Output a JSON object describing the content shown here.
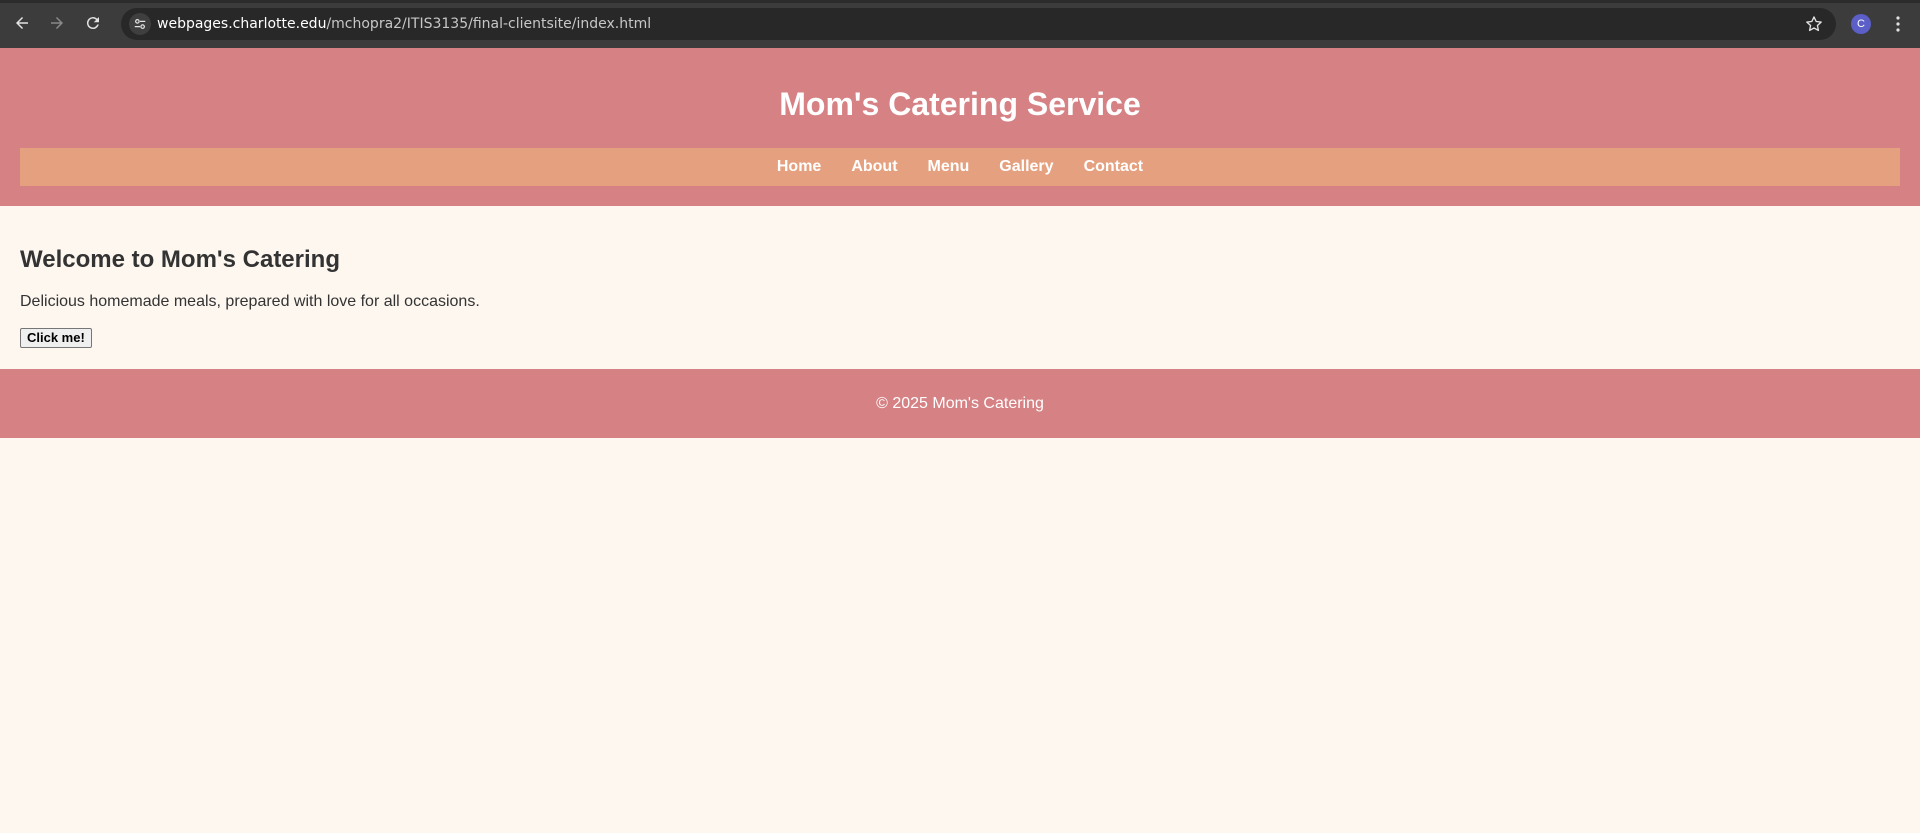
{
  "browser": {
    "url_host": "webpages.charlotte.edu",
    "url_path": "/mchopra2/ITIS3135/final-clientsite/index.html",
    "profile_initial": "C",
    "icons": [
      "back-arrow-icon",
      "forward-arrow-icon",
      "reload-icon",
      "site-info-icon",
      "bookmark-star-icon",
      "kebab-menu-icon"
    ]
  },
  "header": {
    "title": "Mom's Catering Service"
  },
  "nav": {
    "items": [
      {
        "label": "Home"
      },
      {
        "label": "About"
      },
      {
        "label": "Menu"
      },
      {
        "label": "Gallery"
      },
      {
        "label": "Contact"
      }
    ]
  },
  "main": {
    "heading": "Welcome to Mom's Catering",
    "lead": "Delicious homemade meals, prepared with love for all occasions.",
    "button_label": "Click me!"
  },
  "footer": {
    "text": "© 2025 Mom's Catering"
  },
  "colors": {
    "header_bg": "#d68184",
    "nav_bg": "#e5a17f",
    "page_bg": "#fdf7f0",
    "text": "#333333"
  }
}
